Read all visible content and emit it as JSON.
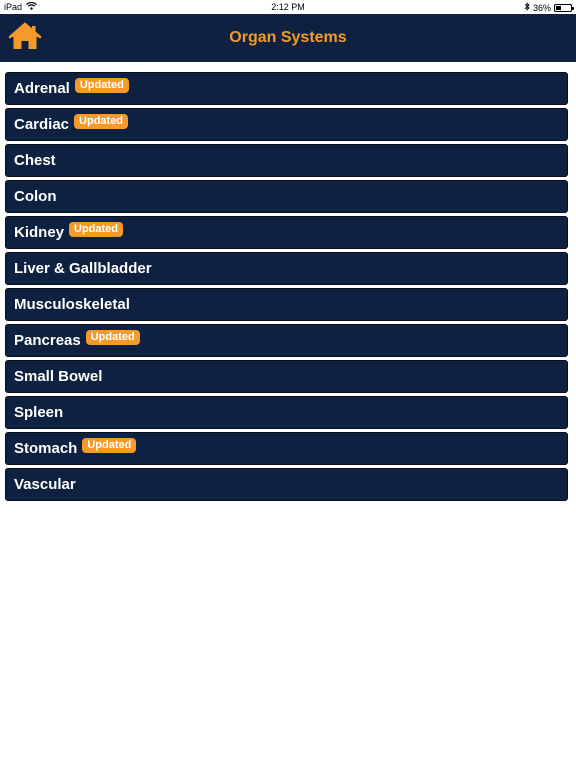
{
  "status_bar": {
    "device": "iPad",
    "time": "2:12 PM",
    "battery": "36%",
    "battery_level": 0.36
  },
  "header": {
    "title": "Organ Systems",
    "home_icon": "home-icon",
    "accent_color": "#f39a2b",
    "bar_color": "#0e2140"
  },
  "badge_text": "Updated",
  "organs": [
    {
      "label": "Adrenal",
      "updated": true
    },
    {
      "label": "Cardiac",
      "updated": true
    },
    {
      "label": "Chest",
      "updated": false
    },
    {
      "label": "Colon",
      "updated": false
    },
    {
      "label": "Kidney",
      "updated": true
    },
    {
      "label": "Liver & Gallbladder",
      "updated": false
    },
    {
      "label": "Musculoskeletal",
      "updated": false
    },
    {
      "label": "Pancreas",
      "updated": true
    },
    {
      "label": "Small Bowel",
      "updated": false
    },
    {
      "label": "Spleen",
      "updated": false
    },
    {
      "label": "Stomach",
      "updated": true
    },
    {
      "label": "Vascular",
      "updated": false
    }
  ]
}
